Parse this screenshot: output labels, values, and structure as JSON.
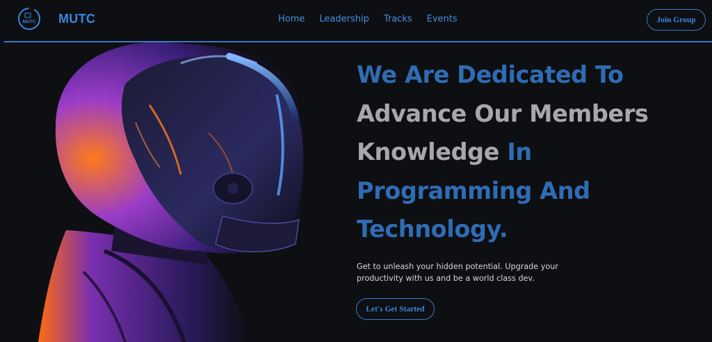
{
  "nav": {
    "logo_text": "MUTC",
    "brand": "MUTC",
    "links": [
      {
        "label": "Home"
      },
      {
        "label": "Leadership"
      },
      {
        "label": "Tracks"
      },
      {
        "label": "Events"
      }
    ],
    "join_label": "Join Group"
  },
  "hero": {
    "headline": {
      "line1": "We Are Dedicated To",
      "line2": "Advance Our Members",
      "line3_a": "Knowledge",
      "line3_b": " In",
      "line4": "Programming And",
      "line5": "Technology."
    },
    "subtext": "Get to unleash your hidden potential. Upgrade your productivity with us and be a world class dev.",
    "cta_label": "Let's Get Started"
  },
  "colors": {
    "background": "#0d0f12",
    "accent_blue": "#3c86e0",
    "headline_blue": "#2f6cb4",
    "headline_gray": "#a8a8ac"
  },
  "icons": {
    "logo": "mutc-logo-icon",
    "hero": "helmet-figure-illustration"
  }
}
